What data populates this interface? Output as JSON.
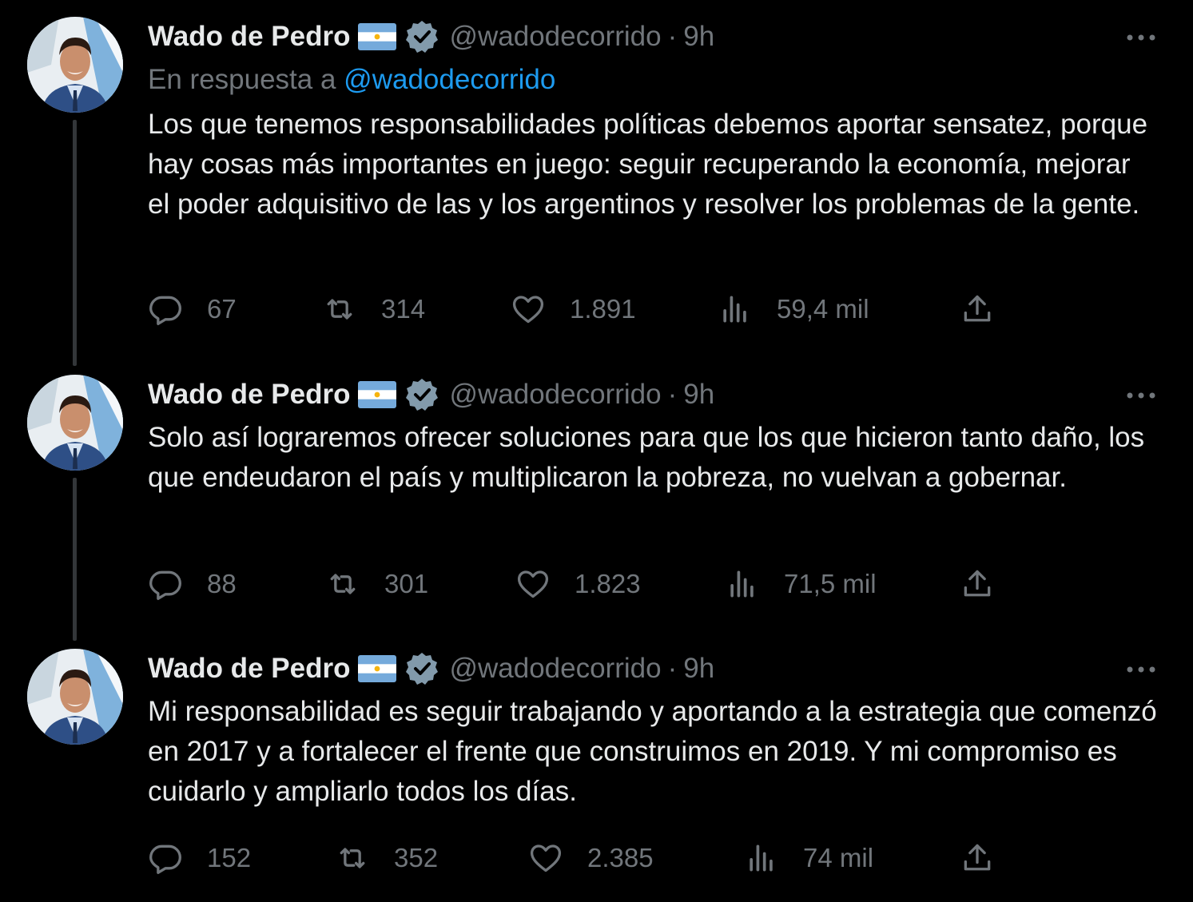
{
  "tweets": [
    {
      "author": {
        "name": "Wado de Pedro",
        "handle": "@wadodecorrido",
        "time": "9h"
      },
      "reply_to": {
        "prefix": "En respuesta a",
        "mention": "@wadodecorrido"
      },
      "text": "Los que tenemos responsabilidades políticas debemos aportar sensatez, porque hay cosas más importantes en juego: seguir recuperando la economía, mejorar el poder adquisitivo de las y los argentinos y resolver los problemas de la gente.",
      "stats": {
        "replies": "67",
        "retweets": "314",
        "likes": "1.891",
        "views": "59,4 mil"
      }
    },
    {
      "author": {
        "name": "Wado de Pedro",
        "handle": "@wadodecorrido",
        "time": "9h"
      },
      "text": "Solo así lograremos ofrecer soluciones para que los que hicieron tanto daño, los que endeudaron el país y multiplicaron la pobreza, no vuelvan a gobernar.",
      "stats": {
        "replies": "88",
        "retweets": "301",
        "likes": "1.823",
        "views": "71,5 mil"
      }
    },
    {
      "author": {
        "name": "Wado de Pedro",
        "handle": "@wadodecorrido",
        "time": "9h"
      },
      "text": "Mi responsabilidad es seguir trabajando y aportando a la estrategia que comenzó en 2017 y a fortalecer el frente que construimos en 2019. Y mi compromiso es cuidarlo y ampliarlo todos los días.",
      "stats": {
        "replies": "152",
        "retweets": "352",
        "likes": "2.385",
        "views": "74 mil"
      }
    }
  ],
  "separator": "·",
  "icons": {
    "reply": "reply-bubble-icon",
    "retweet": "retweet-icon",
    "like": "heart-icon",
    "views": "bar-chart-icon",
    "share": "share-icon",
    "more": "more-dots-icon",
    "verified": "verified-badge-icon",
    "flag": "argentina-flag-emoji"
  },
  "colors": {
    "background": "#000000",
    "text": "#e7e9ea",
    "secondary": "#71767b",
    "mention": "#1d9bf0",
    "verified_badge": "#829aab",
    "thread_line": "#333639"
  }
}
